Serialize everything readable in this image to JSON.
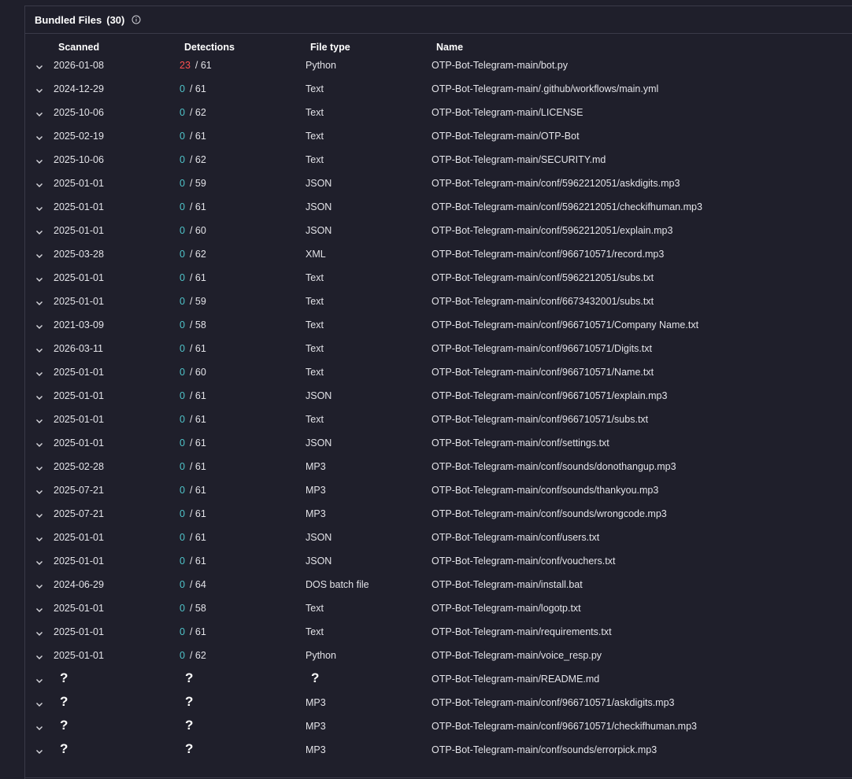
{
  "section": {
    "title": "Bundled Files",
    "count": "(30)"
  },
  "columns": {
    "scanned": "Scanned",
    "detections": "Detections",
    "file_type": "File type",
    "name": "Name"
  },
  "colors": {
    "clean": "#4fc3c9",
    "malicious": "#ff5050",
    "background": "#1f1f2b"
  },
  "files": [
    {
      "scanned": "2026-01-08",
      "detected": "23",
      "total": "/ 61",
      "type": "Python",
      "name": "OTP-Bot-Telegram-main/bot.py"
    },
    {
      "scanned": "2024-12-29",
      "detected": "0",
      "total": "/ 61",
      "type": "Text",
      "name": "OTP-Bot-Telegram-main/.github/workflows/main.yml"
    },
    {
      "scanned": "2025-10-06",
      "detected": "0",
      "total": "/ 62",
      "type": "Text",
      "name": "OTP-Bot-Telegram-main/LICENSE"
    },
    {
      "scanned": "2025-02-19",
      "detected": "0",
      "total": "/ 61",
      "type": "Text",
      "name": "OTP-Bot-Telegram-main/OTP-Bot"
    },
    {
      "scanned": "2025-10-06",
      "detected": "0",
      "total": "/ 62",
      "type": "Text",
      "name": "OTP-Bot-Telegram-main/SECURITY.md"
    },
    {
      "scanned": "2025-01-01",
      "detected": "0",
      "total": "/ 59",
      "type": "JSON",
      "name": "OTP-Bot-Telegram-main/conf/5962212051/askdigits.mp3"
    },
    {
      "scanned": "2025-01-01",
      "detected": "0",
      "total": "/ 61",
      "type": "JSON",
      "name": "OTP-Bot-Telegram-main/conf/5962212051/checkifhuman.mp3"
    },
    {
      "scanned": "2025-01-01",
      "detected": "0",
      "total": "/ 60",
      "type": "JSON",
      "name": "OTP-Bot-Telegram-main/conf/5962212051/explain.mp3"
    },
    {
      "scanned": "2025-03-28",
      "detected": "0",
      "total": "/ 62",
      "type": "XML",
      "name": "OTP-Bot-Telegram-main/conf/966710571/record.mp3"
    },
    {
      "scanned": "2025-01-01",
      "detected": "0",
      "total": "/ 61",
      "type": "Text",
      "name": "OTP-Bot-Telegram-main/conf/5962212051/subs.txt"
    },
    {
      "scanned": "2025-01-01",
      "detected": "0",
      "total": "/ 59",
      "type": "Text",
      "name": "OTP-Bot-Telegram-main/conf/6673432001/subs.txt"
    },
    {
      "scanned": "2021-03-09",
      "detected": "0",
      "total": "/ 58",
      "type": "Text",
      "name": "OTP-Bot-Telegram-main/conf/966710571/Company Name.txt"
    },
    {
      "scanned": "2026-03-11",
      "detected": "0",
      "total": "/ 61",
      "type": "Text",
      "name": "OTP-Bot-Telegram-main/conf/966710571/Digits.txt"
    },
    {
      "scanned": "2025-01-01",
      "detected": "0",
      "total": "/ 60",
      "type": "Text",
      "name": "OTP-Bot-Telegram-main/conf/966710571/Name.txt"
    },
    {
      "scanned": "2025-01-01",
      "detected": "0",
      "total": "/ 61",
      "type": "JSON",
      "name": "OTP-Bot-Telegram-main/conf/966710571/explain.mp3"
    },
    {
      "scanned": "2025-01-01",
      "detected": "0",
      "total": "/ 61",
      "type": "Text",
      "name": "OTP-Bot-Telegram-main/conf/966710571/subs.txt"
    },
    {
      "scanned": "2025-01-01",
      "detected": "0",
      "total": "/ 61",
      "type": "JSON",
      "name": "OTP-Bot-Telegram-main/conf/settings.txt"
    },
    {
      "scanned": "2025-02-28",
      "detected": "0",
      "total": "/ 61",
      "type": "MP3",
      "name": "OTP-Bot-Telegram-main/conf/sounds/donothangup.mp3"
    },
    {
      "scanned": "2025-07-21",
      "detected": "0",
      "total": "/ 61",
      "type": "MP3",
      "name": "OTP-Bot-Telegram-main/conf/sounds/thankyou.mp3"
    },
    {
      "scanned": "2025-07-21",
      "detected": "0",
      "total": "/ 61",
      "type": "MP3",
      "name": "OTP-Bot-Telegram-main/conf/sounds/wrongcode.mp3"
    },
    {
      "scanned": "2025-01-01",
      "detected": "0",
      "total": "/ 61",
      "type": "JSON",
      "name": "OTP-Bot-Telegram-main/conf/users.txt"
    },
    {
      "scanned": "2025-01-01",
      "detected": "0",
      "total": "/ 61",
      "type": "JSON",
      "name": "OTP-Bot-Telegram-main/conf/vouchers.txt"
    },
    {
      "scanned": "2024-06-29",
      "detected": "0",
      "total": "/ 64",
      "type": "DOS batch file",
      "name": "OTP-Bot-Telegram-main/install.bat"
    },
    {
      "scanned": "2025-01-01",
      "detected": "0",
      "total": "/ 58",
      "type": "Text",
      "name": "OTP-Bot-Telegram-main/logotp.txt"
    },
    {
      "scanned": "2025-01-01",
      "detected": "0",
      "total": "/ 61",
      "type": "Text",
      "name": "OTP-Bot-Telegram-main/requirements.txt"
    },
    {
      "scanned": "2025-01-01",
      "detected": "0",
      "total": "/ 62",
      "type": "Python",
      "name": "OTP-Bot-Telegram-main/voice_resp.py"
    },
    {
      "scanned": "?",
      "detected": "?",
      "total": "",
      "type": "?",
      "name": "OTP-Bot-Telegram-main/README.md"
    },
    {
      "scanned": "?",
      "detected": "?",
      "total": "",
      "type": "MP3",
      "name": "OTP-Bot-Telegram-main/conf/966710571/askdigits.mp3"
    },
    {
      "scanned": "?",
      "detected": "?",
      "total": "",
      "type": "MP3",
      "name": "OTP-Bot-Telegram-main/conf/966710571/checkifhuman.mp3"
    },
    {
      "scanned": "?",
      "detected": "?",
      "total": "",
      "type": "MP3",
      "name": "OTP-Bot-Telegram-main/conf/sounds/errorpick.mp3"
    }
  ]
}
